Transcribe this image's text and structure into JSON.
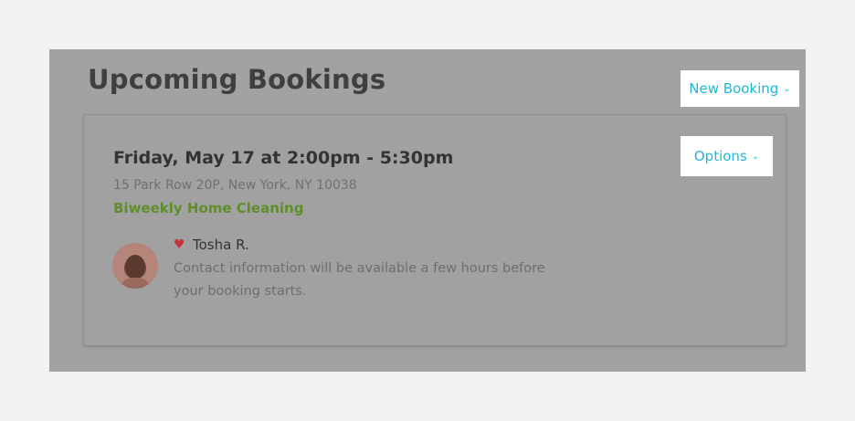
{
  "page": {
    "title": "Upcoming Bookings",
    "new_booking_label": "New Booking",
    "chevron_glyph": "⌄"
  },
  "booking": {
    "datetime": "Friday, May 17 at 2:00pm - 5:30pm",
    "address": "15 Park Row 20P, New York, NY 10038",
    "service": "Biweekly Home Cleaning",
    "options_label": "Options",
    "pro": {
      "name": "Tosha R.",
      "favorite_icon": "heart-icon",
      "contact_note": "Contact information will be available a few hours before your booking starts."
    }
  },
  "colors": {
    "accent": "#1fb8d6",
    "service_green": "#5e8f2a",
    "favorite_red": "#c0353a"
  }
}
